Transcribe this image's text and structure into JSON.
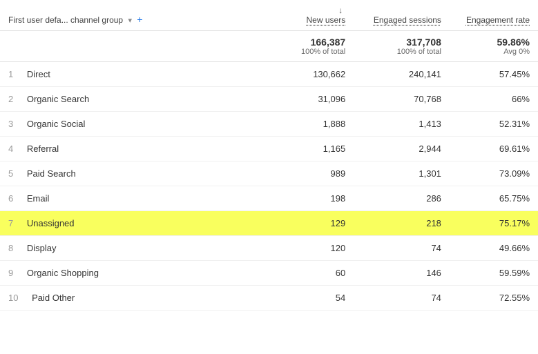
{
  "header": {
    "dimension_label": "First user defa... channel group",
    "dropdown_icon": "▾",
    "add_icon": "+",
    "col_new_users": "New users",
    "col_engaged_sessions": "Engaged sessions",
    "col_engagement_rate": "Engagement rate",
    "sort_arrow": "↓"
  },
  "totals": {
    "new_users_main": "166,387",
    "new_users_sub": "100% of total",
    "engaged_sessions_main": "317,708",
    "engaged_sessions_sub": "100% of total",
    "engagement_rate_main": "59.86%",
    "engagement_rate_sub": "Avg 0%"
  },
  "rows": [
    {
      "num": "1",
      "name": "Direct",
      "new_users": "130,662",
      "engaged_sessions": "240,141",
      "engagement_rate": "57.45%",
      "highlighted": false
    },
    {
      "num": "2",
      "name": "Organic Search",
      "new_users": "31,096",
      "engaged_sessions": "70,768",
      "engagement_rate": "66%",
      "highlighted": false
    },
    {
      "num": "3",
      "name": "Organic Social",
      "new_users": "1,888",
      "engaged_sessions": "1,413",
      "engagement_rate": "52.31%",
      "highlighted": false
    },
    {
      "num": "4",
      "name": "Referral",
      "new_users": "1,165",
      "engaged_sessions": "2,944",
      "engagement_rate": "69.61%",
      "highlighted": false
    },
    {
      "num": "5",
      "name": "Paid Search",
      "new_users": "989",
      "engaged_sessions": "1,301",
      "engagement_rate": "73.09%",
      "highlighted": false
    },
    {
      "num": "6",
      "name": "Email",
      "new_users": "198",
      "engaged_sessions": "286",
      "engagement_rate": "65.75%",
      "highlighted": false
    },
    {
      "num": "7",
      "name": "Unassigned",
      "new_users": "129",
      "engaged_sessions": "218",
      "engagement_rate": "75.17%",
      "highlighted": true
    },
    {
      "num": "8",
      "name": "Display",
      "new_users": "120",
      "engaged_sessions": "74",
      "engagement_rate": "49.66%",
      "highlighted": false
    },
    {
      "num": "9",
      "name": "Organic Shopping",
      "new_users": "60",
      "engaged_sessions": "146",
      "engagement_rate": "59.59%",
      "highlighted": false
    },
    {
      "num": "10",
      "name": "Paid Other",
      "new_users": "54",
      "engaged_sessions": "74",
      "engagement_rate": "72.55%",
      "highlighted": false
    }
  ]
}
